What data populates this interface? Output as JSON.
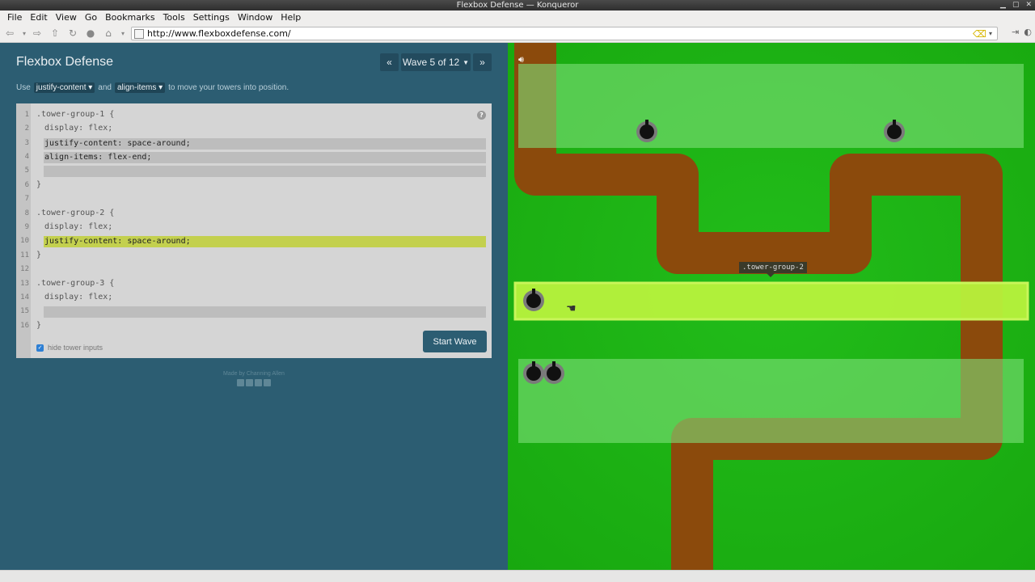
{
  "window": {
    "title": "Flexbox Defense — Konqueror"
  },
  "menu": [
    "File",
    "Edit",
    "View",
    "Go",
    "Bookmarks",
    "Tools",
    "Settings",
    "Window",
    "Help"
  ],
  "toolbar": {
    "url": "http://www.flexboxdefense.com/"
  },
  "app": {
    "title": "Flexbox Defense",
    "wave_label": "Wave 5 of 12",
    "prev_label": "«",
    "next_label": "»",
    "hint": {
      "prefix": "Use",
      "chip1": "justify-content ▾",
      "middle": "and",
      "chip2": "align-items ▾",
      "suffix": "to move your towers into position."
    }
  },
  "editor": {
    "line_numbers": [
      "1",
      "2",
      "3",
      "4",
      "5",
      "6",
      "7",
      "8",
      "9",
      "10",
      "11",
      "12",
      "13",
      "14",
      "15",
      "16"
    ],
    "l1": ".tower-group-1 {",
    "l2": "display: flex;",
    "l3": "justify-content: space-around;",
    "l4": "align-items: flex-end;",
    "l5": "",
    "l6": "}",
    "l8": ".tower-group-2 {",
    "l9": "display: flex;",
    "l10": "justify-content: space-around;",
    "l11": "}",
    "l13": ".tower-group-3 {",
    "l14": "display: flex;",
    "l15": "",
    "l16": "}",
    "help_glyph": "?",
    "start_wave": "Start Wave",
    "hide_inputs": "hide tower inputs",
    "hide_inputs_checked": true
  },
  "footer": {
    "credit": "Made by Channing Allen"
  },
  "game": {
    "tooltip": ".tower-group-2",
    "colors": {
      "grass": "#1db014",
      "path": "#8b4a0c",
      "zone": "#6fdc68",
      "active_zone": "#b4f23b",
      "tower": "#111111",
      "tower_ring": "#7a7a7a"
    }
  }
}
